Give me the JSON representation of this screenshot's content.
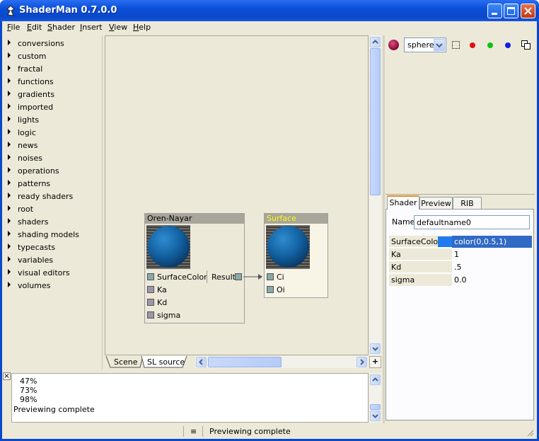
{
  "window": {
    "title": "ShaderMan 0.7.0.0"
  },
  "menu": [
    "File",
    "Edit",
    "Shader",
    "Insert",
    "View",
    "Help"
  ],
  "tree": [
    "conversions",
    "custom",
    "fractal",
    "functions",
    "gradients",
    "imported",
    "lights",
    "logic",
    "news",
    "noises",
    "operations",
    "patterns",
    "ready shaders",
    "root",
    "shaders",
    "shading models",
    "typecasts",
    "variables",
    "visual editors",
    "volumes"
  ],
  "nodes": {
    "oren": {
      "title": "Oren-Nayar",
      "inputs": [
        "SurfaceColor",
        "Ka",
        "Kd",
        "sigma"
      ],
      "output": "Result"
    },
    "surface": {
      "title": "Surface",
      "inputs": [
        "Ci",
        "Oi"
      ]
    }
  },
  "scene_tabs": {
    "scene": "Scene",
    "sl_source": "SL source",
    "plus": "+"
  },
  "preview_toolbar": {
    "shape": "sphere"
  },
  "props": {
    "tabs": [
      "Shader",
      "Preview",
      "RIB"
    ],
    "name_label": "Name",
    "name_value": "defaultname0",
    "rows": [
      {
        "key": "SurfaceColor",
        "value": "color(0,0.5,1)",
        "swatch": "#1e7bf0"
      },
      {
        "key": "Ka",
        "value": "1"
      },
      {
        "key": "Kd",
        "value": ".5"
      },
      {
        "key": "sigma",
        "value": "0.0"
      }
    ]
  },
  "log": {
    "lines": [
      "47%",
      "73%",
      "98%",
      "Previewing complete"
    ],
    "close": "×"
  },
  "status": {
    "glyph": "≡",
    "text": "Previewing complete"
  },
  "colors": {
    "accent": "#316ac5",
    "port": "#8aa9a9",
    "port_gray": "#9a98a8",
    "surface_title": "#ffff00"
  }
}
